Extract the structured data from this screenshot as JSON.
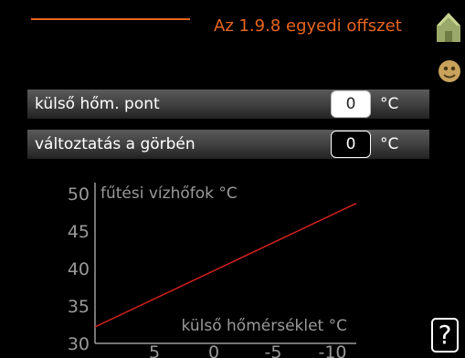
{
  "header": {
    "title": "Az 1.9.8 egyedi offszet",
    "accent_color": "#e8651e",
    "icons": [
      "house-icon",
      "helper-icon"
    ]
  },
  "settings": [
    {
      "label": "külső hőm. pont",
      "value": "0",
      "unit": "°C",
      "selected": true
    },
    {
      "label": "változtatás a görbén",
      "value": "0",
      "unit": "°C",
      "selected": false
    }
  ],
  "chart_data": {
    "type": "line",
    "ylabel": "fűtési vízhőfok °C",
    "xlabel": "külső hőmérséklet °C",
    "y_ticks": [
      "50",
      "45",
      "40",
      "35",
      "30"
    ],
    "x_ticks": [
      "5",
      "0",
      "-5",
      "-10"
    ],
    "ylim": [
      30,
      50
    ],
    "xlim": [
      10,
      -12
    ],
    "series": [
      {
        "color": "#d42020",
        "x": [
          10,
          -12
        ],
        "y": [
          32.2,
          48.7
        ]
      }
    ]
  },
  "help": {
    "label": "?"
  }
}
